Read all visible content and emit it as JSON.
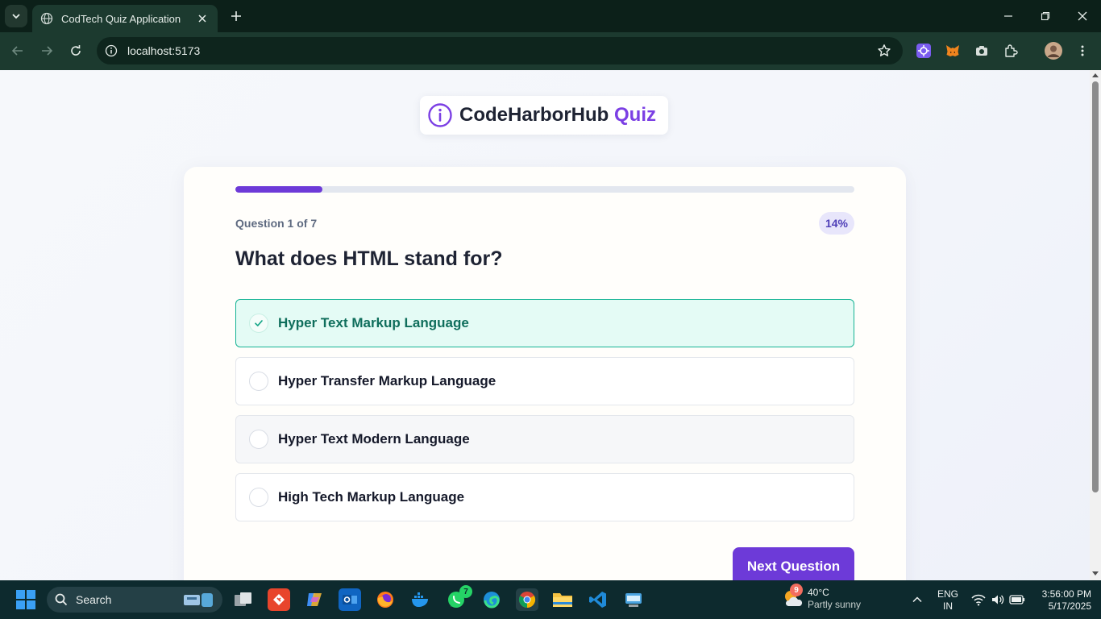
{
  "browser": {
    "tab_title": "CodTech Quiz Application",
    "url": "localhost:5173"
  },
  "page": {
    "brand_name": "CodeHarborHub",
    "brand_accent": "Quiz",
    "progress_fraction": 0.14,
    "question_counter": "Question 1 of 7",
    "progress_label": "14%",
    "question": "What does HTML stand for?",
    "options": [
      {
        "label": "Hyper Text Markup Language",
        "selected": true
      },
      {
        "label": "Hyper Transfer Markup Language",
        "selected": false
      },
      {
        "label": "Hyper Text Modern Language",
        "selected": false
      },
      {
        "label": "High Tech Markup Language",
        "selected": false
      }
    ],
    "next_button": "Next Question"
  },
  "taskbar": {
    "search_label": "Search",
    "whatsapp_badge": "7",
    "weather_badge": "9",
    "weather_temp": "40°C",
    "weather_desc": "Partly sunny",
    "lang_line1": "ENG",
    "lang_line2": "IN",
    "time": "3:56:00 PM",
    "date": "5/17/2025"
  },
  "colors": {
    "accent": "#6d3ad8",
    "selected_border": "#16b394",
    "selected_bg": "#e4fbf5",
    "browser_frame": "#1c3a2f"
  }
}
